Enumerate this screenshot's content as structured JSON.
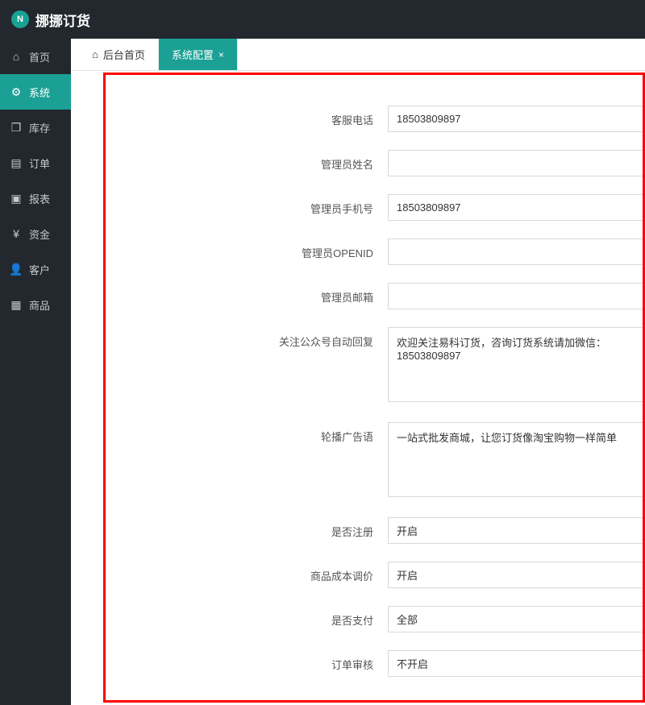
{
  "app": {
    "name": "挪挪订货"
  },
  "sidebar": {
    "items": [
      {
        "label": "首页",
        "icon": "⌂"
      },
      {
        "label": "系统",
        "icon": "⚙"
      },
      {
        "label": "库存",
        "icon": "❒"
      },
      {
        "label": "订单",
        "icon": "▤"
      },
      {
        "label": "报表",
        "icon": "▣"
      },
      {
        "label": "资金",
        "icon": "¥"
      },
      {
        "label": "客户",
        "icon": "👤"
      },
      {
        "label": "商品",
        "icon": "▦"
      }
    ]
  },
  "tabs": {
    "items": [
      {
        "label": "后台首页"
      },
      {
        "label": "系统配置"
      }
    ]
  },
  "form": {
    "fields": [
      {
        "label": "客服电话",
        "type": "text",
        "value": "18503809897"
      },
      {
        "label": "管理员姓名",
        "type": "text",
        "value": ""
      },
      {
        "label": "管理员手机号",
        "type": "text",
        "value": "18503809897"
      },
      {
        "label": "管理员OPENID",
        "type": "text",
        "value": ""
      },
      {
        "label": "管理员邮箱",
        "type": "text",
        "value": ""
      },
      {
        "label": "关注公众号自动回复",
        "type": "textarea",
        "value": "欢迎关注易科订货，咨询订货系统请加微信：18503809897",
        "rows": 5
      },
      {
        "label": "轮播广告语",
        "type": "textarea",
        "value": "一站式批发商城，让您订货像淘宝购物一样简单",
        "rows": 5
      },
      {
        "label": "是否注册",
        "type": "select",
        "value": "开启"
      },
      {
        "label": "商品成本调价",
        "type": "select",
        "value": "开启"
      },
      {
        "label": "是否支付",
        "type": "select",
        "value": "全部"
      },
      {
        "label": "订单审核",
        "type": "select",
        "value": "不开启"
      }
    ]
  }
}
